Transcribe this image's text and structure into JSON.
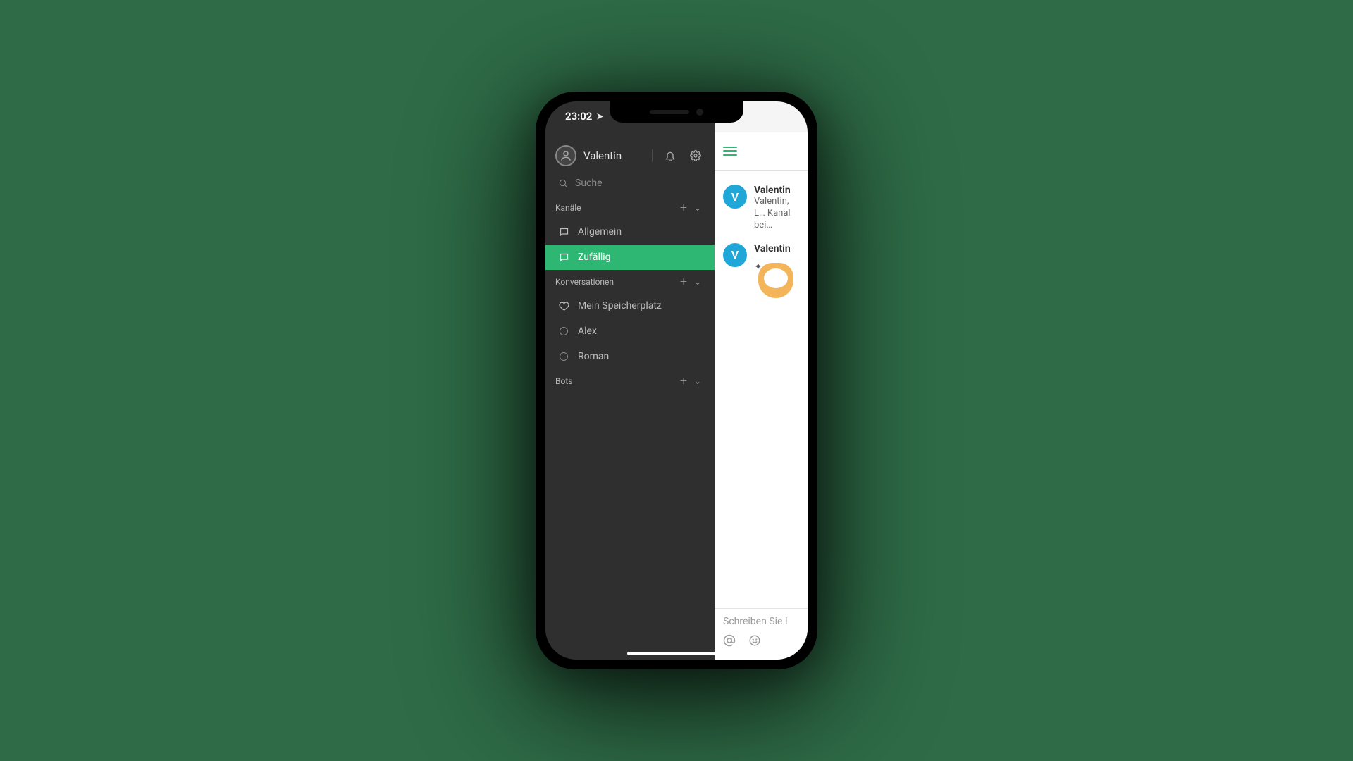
{
  "status": {
    "time": "23:02"
  },
  "profile": {
    "name": "Valentin"
  },
  "search": {
    "placeholder": "Suche"
  },
  "sections": {
    "channels": {
      "label": "Kanäle",
      "items": [
        {
          "label": "Allgemein"
        },
        {
          "label": "Zufällig"
        }
      ]
    },
    "conversations": {
      "label": "Konversationen",
      "items": [
        {
          "label": "Mein Speicherplatz"
        },
        {
          "label": "Alex"
        },
        {
          "label": "Roman"
        }
      ]
    },
    "bots": {
      "label": "Bots"
    }
  },
  "content": {
    "messages": [
      {
        "avatar_initial": "V",
        "name": "Valentin",
        "text": "Valentin, L… Kanal bei…"
      },
      {
        "avatar_initial": "V",
        "name": "Valentin",
        "text": ""
      }
    ],
    "composer_placeholder": "Schreiben Sie I"
  },
  "colors": {
    "accent": "#2eb673",
    "avatar_blue": "#1ea7d8",
    "sidebar_bg": "#2f2f2f"
  }
}
